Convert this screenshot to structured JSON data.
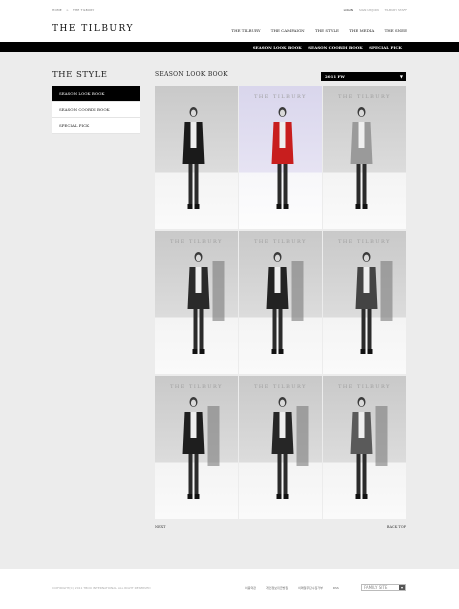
{
  "header": {
    "breadcrumb": [
      "HOME",
      "THE TILBURY"
    ],
    "util_links": [
      "LOGIN",
      "SIGN UP/JOIN",
      "TILBURY STAFF"
    ],
    "logo": "THE TILBURY",
    "main_nav": [
      "THE TILBURY",
      "THE CAMPAIGN",
      "THE STYLE",
      "THE MEDIA",
      "THE SNEE"
    ],
    "sub_nav": [
      "SEASON LOOK BOOK",
      "SEASON COORDI BOOK",
      "SPECIAL PICK"
    ]
  },
  "sidebar": {
    "title": "THE STYLE",
    "items": [
      {
        "label": "SEASON LOOK BOOK",
        "active": true
      },
      {
        "label": "SEASON COORDI BOOK",
        "active": false
      },
      {
        "label": "SPECIAL PICK",
        "active": false
      }
    ]
  },
  "main": {
    "title": "SEASON LOOK BOOK",
    "season_select": "2011 FW",
    "photos": [
      {
        "brand": "",
        "accent": "#1a1a1a",
        "tone": "grey"
      },
      {
        "brand": "THE TILBURY",
        "accent": "#c81e1e",
        "tone": "purple"
      },
      {
        "brand": "THE TILBURY",
        "accent": "#9a9a9a",
        "tone": "grey"
      },
      {
        "brand": "THE TILBURY",
        "accent": "#2a2a2a",
        "tone": "grey"
      },
      {
        "brand": "THE TILBURY",
        "accent": "#222222",
        "tone": "grey"
      },
      {
        "brand": "THE TILBURY",
        "accent": "#444444",
        "tone": "grey"
      },
      {
        "brand": "THE TILBURY",
        "accent": "#1e1e1e",
        "tone": "grey"
      },
      {
        "brand": "THE TILBURY",
        "accent": "#262626",
        "tone": "grey"
      },
      {
        "brand": "THE TILBURY",
        "accent": "#5a5a5a",
        "tone": "grey"
      }
    ],
    "pager_label": "NEXT",
    "back_top_label": "BACK TOP"
  },
  "footer": {
    "copyright": "COPYRIGHT(C) 2011 TBOO INTERNATIONAL ALL RIGHT RESERVED",
    "links": [
      "이용약관",
      "개인정보취급방침",
      "이메일무단수집거부",
      "RSS"
    ],
    "family_site_label": "FAMILY SITE"
  }
}
